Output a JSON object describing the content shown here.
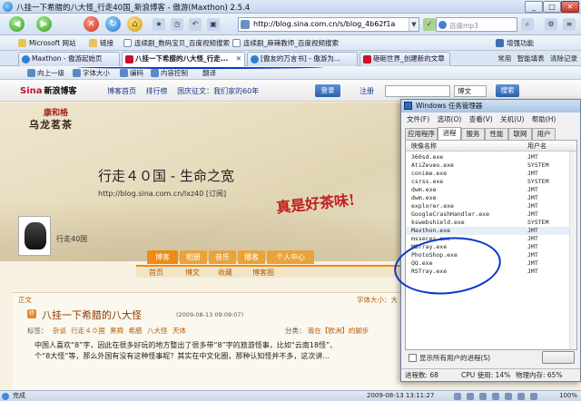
{
  "window": {
    "title": "八挂一下希腊的八大怪_行走40国_新浪博客 - 傲游(Maxthon) 2.5.4",
    "min": "_",
    "max": "□",
    "close": "✕"
  },
  "nav": {
    "url": "http://blog.sina.com.cn/s/blog_4b62f1a",
    "search_placeholder": "百度mp3"
  },
  "favorites": {
    "items": [
      "Microsoft 网站",
      "链接",
      "连续剧_数码宝贝_百度视频搜索",
      "连续剧_麻辣教师_百度视频搜索"
    ],
    "right": [
      "增强功能"
    ]
  },
  "tabs": {
    "items": [
      {
        "label": "Maxthon - 傲游起始页"
      },
      {
        "label": "八挂一下希腊的八大怪_行走..."
      },
      {
        "label": "[傲友的万言书] - 傲游为..."
      },
      {
        "label": "砸砸世界_创建新的文章"
      }
    ],
    "right": [
      "常用",
      "智能填表",
      "清除记录"
    ]
  },
  "toolbar2": {
    "items": [
      "向上一级",
      "字体大小",
      "编码",
      "内容控制",
      "翻译"
    ]
  },
  "sina": {
    "logo": "Sina",
    "logo_suffix": "新浪博客",
    "nav": [
      "博客首页",
      "排行榜",
      "国庆征文：我们家的60年"
    ],
    "login": "登录",
    "register": "注册",
    "search_select": "博文",
    "search_button": "搜索"
  },
  "blog": {
    "brand_small": "康和格",
    "brand_big": "乌龙茗茶",
    "title": "行走４０国 - 生命之宽",
    "url": "http://blog.sina.com.cn/lxz40 [订阅]",
    "slogan": "真是好茶味!",
    "author": "行走40国",
    "tabs": [
      "博客",
      "相册",
      "音乐",
      "播客",
      "个人中心"
    ],
    "subnav": [
      "首页",
      "博文",
      "收藏",
      "博客圈"
    ]
  },
  "post": {
    "section": "正文",
    "font_label": "字体大小：大",
    "icon": "转",
    "title": "八挂一下希腊的八大怪",
    "date": "(2009-08-13 09:09:07)",
    "tags_label": "标签：",
    "tags": [
      "杂谈",
      "行走４０国",
      "黑舜",
      "希腊",
      "八大怪",
      "天体"
    ],
    "category_label": "分类：",
    "category": "我在【欧洲】的脚步",
    "body_lines": [
      "中国人喜欢“8”字，因此在很多好玩的地方整出了很多带“8”字的旅游怪事，比如“云南18怪”、",
      "个“8大怪”等，那么外国有没有这种怪事呢？其实在中文化圈，那种认知怪并不多，这次讲..."
    ]
  },
  "taskmgr": {
    "title": "Windows 任务管理器",
    "menu": [
      "文件(F)",
      "选项(O)",
      "查看(V)",
      "关机(U)",
      "帮助(H)"
    ],
    "tabs": [
      "应用程序",
      "进程",
      "服务",
      "性能",
      "联网",
      "用户"
    ],
    "columns": [
      "映像名称",
      "用户名"
    ],
    "rows": [
      {
        "name": "360sd.exe",
        "user": "JMT"
      },
      {
        "name": "AtiZeveo.exe",
        "user": "SYSTEM"
      },
      {
        "name": "conime.exe",
        "user": "JMT"
      },
      {
        "name": "csrss.exe",
        "user": "SYSTEM"
      },
      {
        "name": "dwm.exe",
        "user": "JMT"
      },
      {
        "name": "dwm.exe",
        "user": "JMT"
      },
      {
        "name": "explorer.exe",
        "user": "JMT"
      },
      {
        "name": "GoogleCrashHandler.exe",
        "user": "JMT"
      },
      {
        "name": "kswebshield.exe",
        "user": "SYSTEM"
      },
      {
        "name": "Maxthon.exe",
        "user": "JMT"
      },
      {
        "name": "msseces.exe",
        "user": "JMT"
      },
      {
        "name": "MSTray.exe",
        "user": "JMT"
      },
      {
        "name": "PhotoShop.exe",
        "user": "JMT"
      },
      {
        "name": "QQ.exe",
        "user": "JMT"
      },
      {
        "name": "RSTray.exe",
        "user": "JMT"
      }
    ],
    "show_all": "显示所有用户的进程(S)",
    "status_processes": "进程数: 68",
    "status_cpu": "CPU 使用: 14%",
    "status_mem": "物理内存: 65%"
  },
  "status": {
    "done": "完成",
    "clock": "2009-08-13 13:11:27",
    "zoom": "100%"
  },
  "colors": {
    "accent_ink": "#0a35c8",
    "sina_red": "#c8102e",
    "blog_orange": "#f08a15"
  }
}
